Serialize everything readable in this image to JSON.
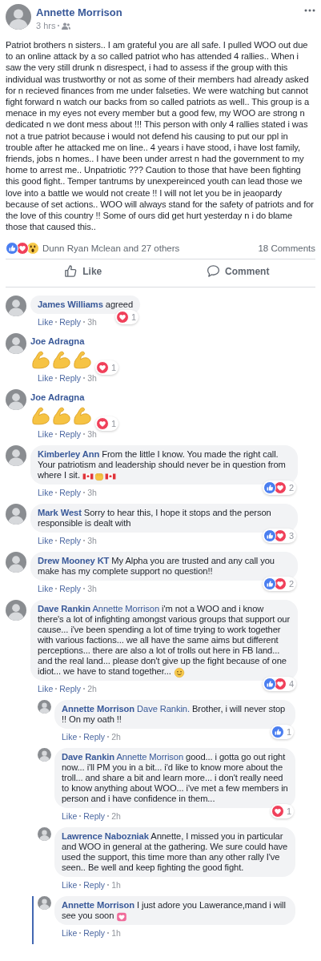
{
  "post": {
    "author": "Annette Morrison",
    "time": "3 hrs",
    "body": "Patriot brothers n sisters.. I am grateful you are all safe. I pulled WOO out due to an online attack by a so called patriot who has attended 4 rallies.. When i saw the very still drunk n disrespect, i had to assess if the group with this individual was trustworthy or not as some of their members had already asked for n recieved finances from me under falseties. We were watching but cannot fight forward n watch our backs from so called patriots as well.. This group is a menace in my eyes not every member but a good few, my WOO are strong n dedicated n we dont mess about !!! This person with only 4 rallies stated i was not a true patriot because i would not defend his causing to put our ppl in trouble after he attacked me on line.. 4 years i have stood, i have lost family, friends, jobs n homes.. I have been under arrest n had the government to my home to arrest me.. Unpatriotic ??? Caution to those that have been fighting this good fight.. Temper tantrums by unexpereinced youth can lead those we love into a battle we would not create !! I will not let you be in jeaopardy because of set actions.. WOO will always stand for the safety of patriots and for the love of this country !! Some of ours did get hurt yesterday n i do blame those that caused this..",
    "reactions": {
      "types": [
        {
          "kind": "like"
        },
        {
          "kind": "love"
        },
        {
          "kind": "wow"
        }
      ],
      "summary": "Dunn Ryan Mclean and 27 others"
    },
    "comment_count": "18 Comments",
    "actions": [
      {
        "kind": "like",
        "label": "Like"
      },
      {
        "kind": "comment",
        "label": "Comment"
      }
    ]
  },
  "comments": [
    {
      "kind": "text",
      "author": "James Williams",
      "text": "agreed",
      "actions": [
        "Like",
        "Reply"
      ],
      "time": "3h",
      "reactions": {
        "types": [
          {
            "kind": "love"
          }
        ],
        "count": "1"
      }
    },
    {
      "kind": "emoji",
      "author": "Joe Adragna",
      "emojis": [
        {
          "kind": "biceps"
        },
        {
          "kind": "biceps"
        },
        {
          "kind": "biceps"
        }
      ],
      "actions": [
        "Like",
        "Reply"
      ],
      "time": "3h",
      "reactions": {
        "types": [
          {
            "kind": "love"
          }
        ],
        "count": "1"
      }
    },
    {
      "kind": "emoji",
      "author": "Joe Adragna",
      "emojis": [
        {
          "kind": "biceps"
        },
        {
          "kind": "biceps"
        },
        {
          "kind": "biceps"
        }
      ],
      "actions": [
        "Like",
        "Reply"
      ],
      "time": "3h",
      "reactions": {
        "types": [
          {
            "kind": "love"
          }
        ],
        "count": "1"
      }
    },
    {
      "kind": "text",
      "author": "Kimberley Ann",
      "text": "From the little I know. You made the right call. Your patriotism and leadership should never be in question from where I sit.",
      "emojis": [
        {
          "kind": "flag"
        },
        {
          "kind": "fist"
        },
        {
          "kind": "flag"
        }
      ],
      "actions": [
        "Like",
        "Reply"
      ],
      "time": "3h",
      "reactions": {
        "types": [
          {
            "kind": "like"
          },
          {
            "kind": "love"
          }
        ],
        "count": "2"
      }
    },
    {
      "kind": "text",
      "author": "Mark West",
      "text": "Sorry to hear this, I hope it stops and the person responsible is dealt with",
      "actions": [
        "Like",
        "Reply"
      ],
      "time": "3h",
      "reactions": {
        "types": [
          {
            "kind": "like"
          },
          {
            "kind": "love"
          }
        ],
        "count": "3"
      }
    },
    {
      "kind": "text",
      "author": "Drew Mooney KT",
      "text": "My Alpha you are trusted and any call you make has my complete support no question!!",
      "actions": [
        "Like",
        "Reply"
      ],
      "time": "3h",
      "reactions": {
        "types": [
          {
            "kind": "like"
          },
          {
            "kind": "love"
          }
        ],
        "count": "2"
      }
    },
    {
      "kind": "text",
      "author": "Dave Rankin",
      "mention": "Annette Morrison",
      "text": "i'm not a WOO and i know there's a lot of infighting amongst various groups that support our cause... i've been spending a lot of time trying to work together with various factions... we all have the same aims but different perceptions... there are also a lot of trolls out here in FB land... and the real land... please don't give up the fight because of one idiot... we have to stand together...",
      "emojis": [
        {
          "kind": "smile"
        }
      ],
      "actions": [
        "Like",
        "Reply"
      ],
      "time": "2h",
      "reactions": {
        "types": [
          {
            "kind": "like"
          },
          {
            "kind": "love"
          }
        ],
        "count": "4"
      },
      "replies": [
        {
          "kind": "text",
          "highlighted": false,
          "author": "Annette Morrison",
          "mention": "Dave Rankin.",
          "text": "Brother, i will never stop !! On my oath !!",
          "actions": [
            "Like",
            "Reply"
          ],
          "time": "2h",
          "reactions": {
            "types": [
              {
                "kind": "like"
              }
            ],
            "count": "1"
          }
        },
        {
          "kind": "text",
          "highlighted": false,
          "author": "Dave Rankin",
          "mention": "Annette Morrison",
          "text": "good... i gotta go out right now... i'll PM you in a bit... i'd like to know more about the troll... and share a bit and learn more... i don't really need to know anything about WOO... i've met a few members in person and i have confidence in them...",
          "actions": [
            "Like",
            "Reply"
          ],
          "time": "2h",
          "reactions": {
            "types": [
              {
                "kind": "love"
              }
            ],
            "count": "1"
          }
        },
        {
          "kind": "text",
          "highlighted": false,
          "author": "Lawrence Nabozniak",
          "text": "Annette, I missed you in particular and WOO in general at the gathering. We sure could have used the support, this time more than any other rally I've seen.. Be well and keep fighting the good fight.",
          "actions": [
            "Like",
            "Reply"
          ],
          "time": "1h"
        },
        {
          "kind": "text",
          "highlighted": true,
          "author": "Annette Morrison",
          "text": "I just adore you Lawerance,mand i will see you soon",
          "emojis": [
            {
              "kind": "heart"
            }
          ],
          "actions": [
            "Like",
            "Reply"
          ],
          "time": "1h"
        }
      ]
    }
  ]
}
